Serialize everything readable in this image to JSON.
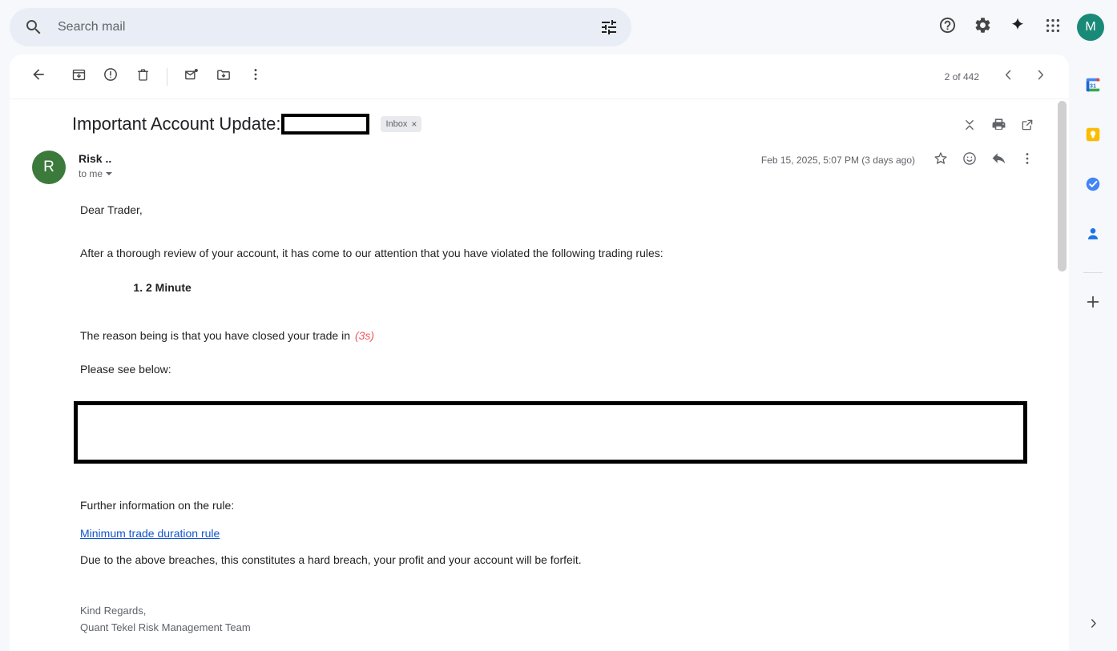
{
  "search": {
    "placeholder": "Search mail",
    "value": "",
    "icon": "search-icon",
    "filter_icon": "filter-options-icon"
  },
  "topbar": {
    "help_icon": "help-circle-icon",
    "settings_icon": "gear-icon",
    "gemini_icon": "sparkle-icon",
    "apps_icon": "apps-grid-icon",
    "avatar_initial": "M",
    "avatar_color": "#1a8a78"
  },
  "toolbar": {
    "back_label": "Back",
    "archive_label": "Archive",
    "spam_label": "Report spam",
    "delete_label": "Delete",
    "unread_label": "Mark as unread",
    "move_label": "Move to",
    "more_label": "More",
    "pager_count": "2 of 442",
    "prev_label": "Newer",
    "next_label": "Older"
  },
  "subject": {
    "text": "Important Account Update:",
    "redacted": true,
    "label_chip": "Inbox",
    "label_remove": "×",
    "collapse_label": "Collapse all",
    "print_label": "Print all",
    "popout_label": "In new window"
  },
  "message": {
    "avatar_initial": "R",
    "avatar_color": "#3c7a3c",
    "sender": "Risk ..",
    "recipient": "to me",
    "date": "Feb 15, 2025, 5:07 PM (3 days ago)",
    "star_label": "Star",
    "react_label": "Add reaction",
    "reply_label": "Reply",
    "more_label": "More"
  },
  "body": {
    "greeting": "Dear Trader,",
    "intro": "After a thorough review of your account, it has come to our attention that you have violated the following trading rules:",
    "rules": [
      {
        "number": "1.",
        "text": "2 Minute"
      }
    ],
    "reason_prefix": "The reason being is that you have closed your trade in",
    "reason_value": "(3s)",
    "reason_color": "#f0565b",
    "see_below": "Please see below:",
    "further_info": "Further information on the rule:",
    "link_text": "Minimum trade duration rule",
    "link_color": "#1155cc",
    "breach_text": "Due to the above breaches, this constitutes a hard breach, your profit and your account will be forfeit.",
    "signoff": "Kind Regards,",
    "signature": "Quant Tekel Risk Management Team"
  },
  "sidepanel": {
    "calendar_icon": "google-calendar-icon",
    "keep_icon": "google-keep-icon",
    "tasks_icon": "google-tasks-icon",
    "contacts_icon": "google-contacts-icon",
    "add_icon": "add-plus-icon",
    "expand_icon": "chevron-right-icon"
  }
}
